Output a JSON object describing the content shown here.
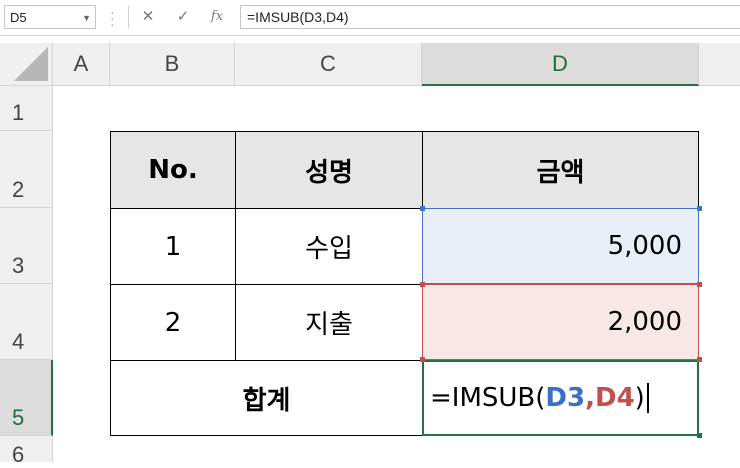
{
  "formula_bar": {
    "name_box": "D5",
    "cancel_icon": "✕",
    "enter_icon": "✓",
    "fx_icon": "fx",
    "formula": "=IMSUB(D3,D4)"
  },
  "columns": [
    "A",
    "B",
    "C",
    "D"
  ],
  "rows": [
    "1",
    "2",
    "3",
    "4",
    "5",
    "6"
  ],
  "selected_cell": "D5",
  "table": {
    "headers": [
      "No.",
      "성명",
      "금액"
    ],
    "rows": [
      {
        "no": "1",
        "name": "수입",
        "amount": "5,000"
      },
      {
        "no": "2",
        "name": "지출",
        "amount": "2,000"
      }
    ],
    "total_label": "합계",
    "edit_formula": {
      "prefix": "=IMSUB(",
      "ref1": "D3",
      "comma": ",",
      "ref2": "D4",
      "suffix": ")"
    }
  },
  "colors": {
    "ref1": "#3a6fc6",
    "ref2": "#c0504d",
    "active": "#217346"
  }
}
